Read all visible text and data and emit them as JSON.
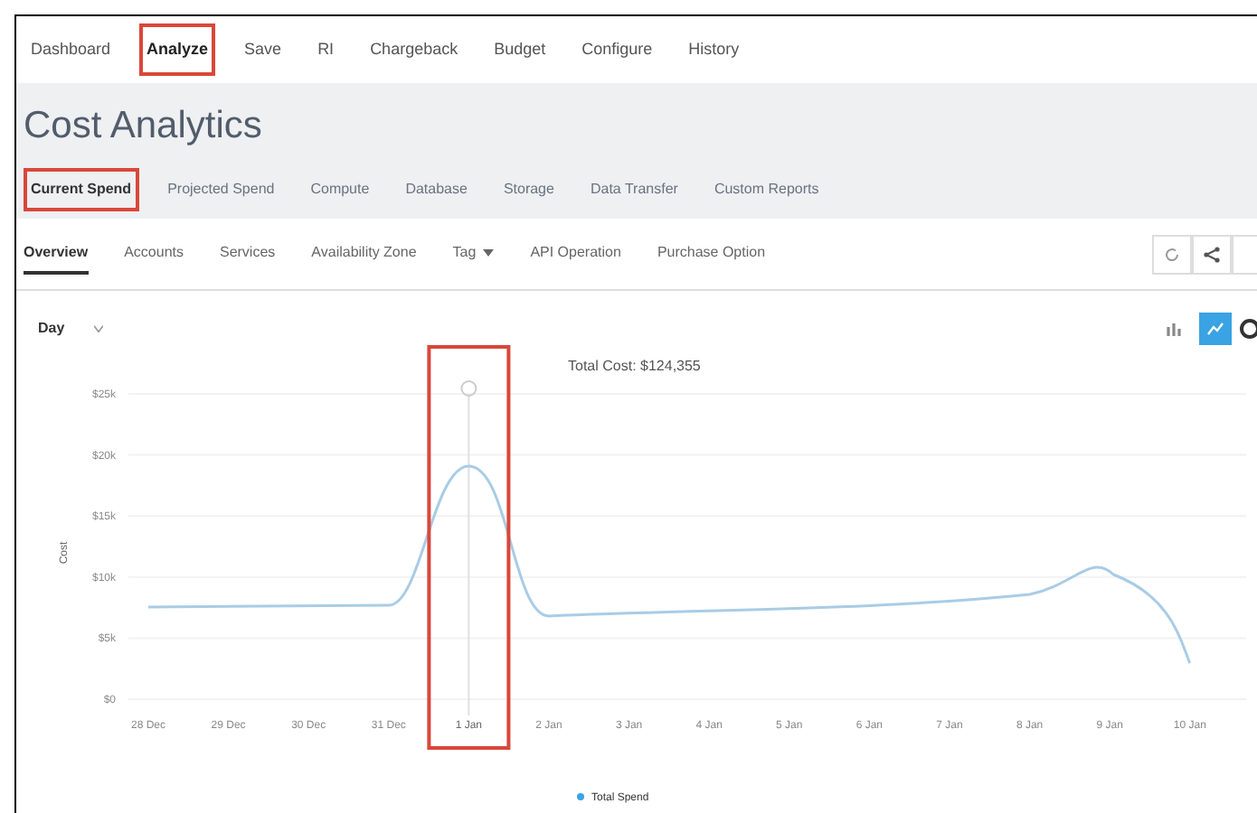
{
  "top_nav": [
    {
      "label": "Dashboard",
      "selected": false,
      "highlighted": false
    },
    {
      "label": "Analyze",
      "selected": true,
      "highlighted": true
    },
    {
      "label": "Save",
      "selected": false,
      "highlighted": false
    },
    {
      "label": "RI",
      "selected": false,
      "highlighted": false
    },
    {
      "label": "Chargeback",
      "selected": false,
      "highlighted": false
    },
    {
      "label": "Budget",
      "selected": false,
      "highlighted": false
    },
    {
      "label": "Configure",
      "selected": false,
      "highlighted": false
    },
    {
      "label": "History",
      "selected": false,
      "highlighted": false
    }
  ],
  "page_title": "Cost Analytics",
  "tabs": [
    {
      "label": "Current Spend",
      "selected": true,
      "highlighted": true
    },
    {
      "label": "Projected Spend",
      "selected": false,
      "highlighted": false
    },
    {
      "label": "Compute",
      "selected": false,
      "highlighted": false
    },
    {
      "label": "Database",
      "selected": false,
      "highlighted": false
    },
    {
      "label": "Storage",
      "selected": false,
      "highlighted": false
    },
    {
      "label": "Data Transfer",
      "selected": false,
      "highlighted": false
    },
    {
      "label": "Custom Reports",
      "selected": false,
      "highlighted": false
    }
  ],
  "sub_tabs": [
    {
      "label": "Overview",
      "selected": true,
      "kind": "tab"
    },
    {
      "label": "Accounts",
      "selected": false,
      "kind": "tab"
    },
    {
      "label": "Services",
      "selected": false,
      "kind": "tab"
    },
    {
      "label": "Availability Zone",
      "selected": false,
      "kind": "tab"
    },
    {
      "label": "Tag",
      "selected": false,
      "kind": "dropdown"
    },
    {
      "label": "API Operation",
      "selected": false,
      "kind": "tab"
    },
    {
      "label": "Purchase Option",
      "selected": false,
      "kind": "tab"
    }
  ],
  "chart": {
    "granularity": "Day",
    "view_toggle": [
      {
        "kind": "bar",
        "selected": false
      },
      {
        "kind": "line",
        "selected": true
      }
    ],
    "tooltip": "Total Cost: $124,355",
    "ylabel": "Cost",
    "yticks": [
      "$25k",
      "$20k",
      "$15k",
      "$10k",
      "$5k",
      "$0"
    ],
    "xticks": [
      {
        "label": "28 Dec",
        "highlighted": false
      },
      {
        "label": "29 Dec",
        "highlighted": false
      },
      {
        "label": "30 Dec",
        "highlighted": false
      },
      {
        "label": "31 Dec",
        "highlighted": false
      },
      {
        "label": "1 Jan",
        "highlighted": true
      },
      {
        "label": "2 Jan",
        "highlighted": false
      },
      {
        "label": "3 Jan",
        "highlighted": false
      },
      {
        "label": "4 Jan",
        "highlighted": false
      },
      {
        "label": "5 Jan",
        "highlighted": false
      },
      {
        "label": "6 Jan",
        "highlighted": false
      },
      {
        "label": "7 Jan",
        "highlighted": false
      },
      {
        "label": "8 Jan",
        "highlighted": false
      },
      {
        "label": "9 Jan",
        "highlighted": false
      },
      {
        "label": "10 Jan",
        "highlighted": false
      }
    ],
    "legend": "Total Spend"
  }
}
